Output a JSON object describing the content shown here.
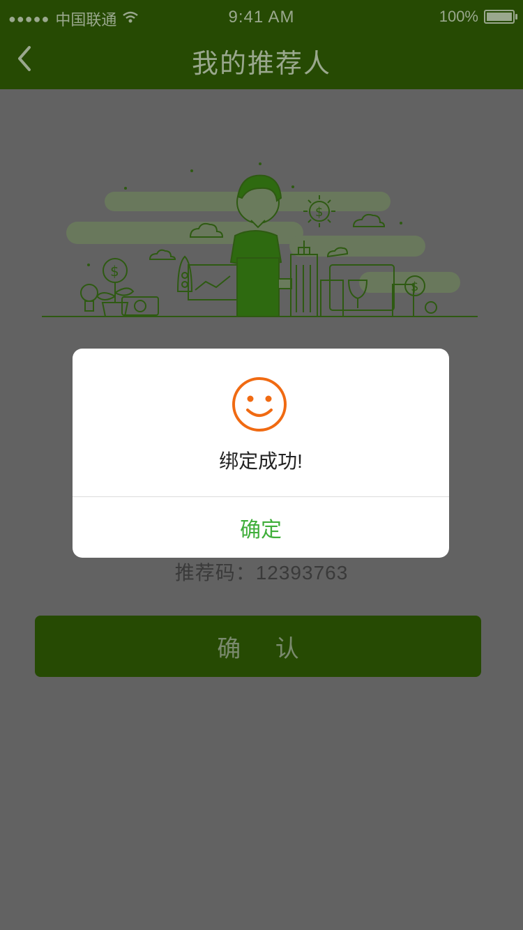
{
  "status_bar": {
    "signal_dots": "●●●●●",
    "carrier": "中国联通",
    "time": "9:41 AM",
    "battery_percent": "100%",
    "battery_level": 1.0
  },
  "nav": {
    "title": "我的推荐人",
    "back_icon": "chevron-left-icon"
  },
  "main": {
    "referral_label": "推荐码：",
    "referral_code": "12393763",
    "confirm_label": "确 认"
  },
  "dialog": {
    "icon": "smiley-face-icon",
    "message": "绑定成功!",
    "ok_label": "确定"
  },
  "colors": {
    "nav_bg": "#264a03",
    "overlay_bg": "#626262",
    "smiley": "#f06a12",
    "ok_text": "#3fae3a"
  }
}
